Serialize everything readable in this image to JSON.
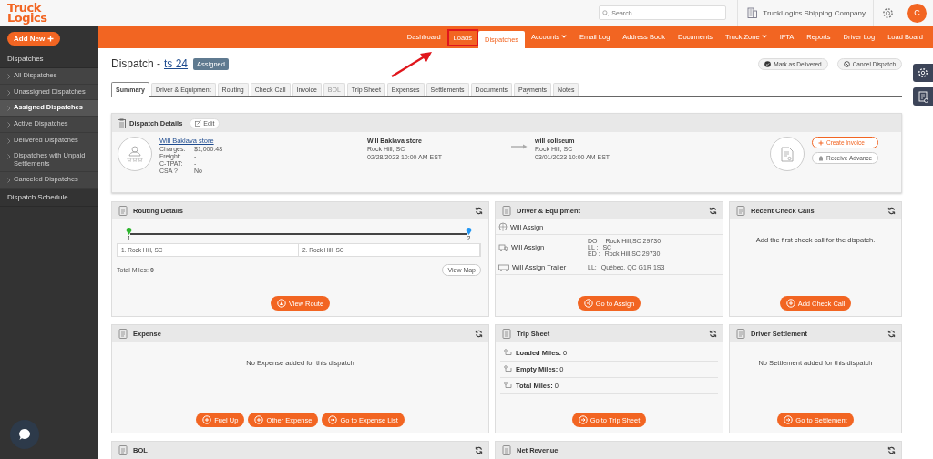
{
  "logo": {
    "line1": "Truck",
    "line2": "Logics"
  },
  "search": {
    "placeholder": "Search"
  },
  "company": "TruckLogics Shipping Company",
  "avatar": "C",
  "add_new": "Add New",
  "sidebar": [
    {
      "kind": "section",
      "label": "Dispatches"
    },
    {
      "kind": "item",
      "label": "All Dispatches",
      "selected": false
    },
    {
      "kind": "item",
      "label": "Unassigned Dispatches",
      "selected": false
    },
    {
      "kind": "item",
      "label": "Assigned Dispatches",
      "selected": true
    },
    {
      "kind": "item",
      "label": "Active Dispatches",
      "selected": false
    },
    {
      "kind": "item",
      "label": "Delivered Dispatches",
      "selected": false
    },
    {
      "kind": "item",
      "label": "Dispatches with Unpaid Settlements",
      "selected": false
    },
    {
      "kind": "item",
      "label": "Canceled Dispatches",
      "selected": false
    },
    {
      "kind": "section",
      "label": "Dispatch Schedule"
    }
  ],
  "nav": [
    {
      "label": "Dashboard",
      "selected": false,
      "dropdown": false,
      "highlighted": false
    },
    {
      "label": "Loads",
      "selected": false,
      "dropdown": false,
      "highlighted": true
    },
    {
      "label": "Dispatches",
      "selected": true,
      "dropdown": false,
      "highlighted": false
    },
    {
      "label": "Accounts",
      "selected": false,
      "dropdown": true,
      "highlighted": false
    },
    {
      "label": "Email Log",
      "selected": false,
      "dropdown": false,
      "highlighted": false
    },
    {
      "label": "Address Book",
      "selected": false,
      "dropdown": false,
      "highlighted": false
    },
    {
      "label": "Documents",
      "selected": false,
      "dropdown": false,
      "highlighted": false
    },
    {
      "label": "Truck Zone",
      "selected": false,
      "dropdown": true,
      "highlighted": false
    },
    {
      "label": "IFTA",
      "selected": false,
      "dropdown": false,
      "highlighted": false
    },
    {
      "label": "Reports",
      "selected": false,
      "dropdown": false,
      "highlighted": false
    },
    {
      "label": "Driver Log",
      "selected": false,
      "dropdown": false,
      "highlighted": false
    },
    {
      "label": "Load Board",
      "selected": false,
      "dropdown": false,
      "highlighted": false
    }
  ],
  "title": {
    "prefix": "Dispatch -",
    "link": "ts 24",
    "status": "Assigned"
  },
  "actions": [
    {
      "kind": "check",
      "label": "Mark as Delivered"
    },
    {
      "kind": "cancel",
      "label": "Cancel Dispatch"
    }
  ],
  "tabs": [
    {
      "label": "Summary",
      "selected": true,
      "disabled": false
    },
    {
      "label": "Driver & Equipment",
      "selected": false,
      "disabled": false
    },
    {
      "label": "Routing",
      "selected": false,
      "disabled": false
    },
    {
      "label": "Check Call",
      "selected": false,
      "disabled": false
    },
    {
      "label": "Invoice",
      "selected": false,
      "disabled": false
    },
    {
      "label": "BOL",
      "selected": false,
      "disabled": true
    },
    {
      "label": "Trip Sheet",
      "selected": false,
      "disabled": false
    },
    {
      "label": "Expenses",
      "selected": false,
      "disabled": false
    },
    {
      "label": "Settlements",
      "selected": false,
      "disabled": false
    },
    {
      "label": "Documents",
      "selected": false,
      "disabled": false
    },
    {
      "label": "Payments",
      "selected": false,
      "disabled": false
    },
    {
      "label": "Notes",
      "selected": false,
      "disabled": false
    }
  ],
  "details": {
    "title": "Dispatch Details",
    "edit": "Edit",
    "customer": "Will Baklava store",
    "fields": [
      {
        "label": "Charges:",
        "value": "$1,000.48"
      },
      {
        "label": "Freight:",
        "value": "-"
      },
      {
        "label": "C-TPAT:",
        "value": "-"
      },
      {
        "label": "CSA ?",
        "value": "No"
      }
    ],
    "pickup": {
      "name": "Will Baklava store",
      "city": "Rock Hill, SC",
      "time": "02/28/2023 10:00 AM EST"
    },
    "delivery": {
      "name": "will coliseum",
      "city": "Rock Hill, SC",
      "time": "03/01/2023 10:00 AM EST"
    },
    "buttons": [
      {
        "kind": "primary",
        "label": "Create Invoice"
      },
      {
        "kind": "plain",
        "label": "Receive Advance"
      }
    ]
  },
  "panels": [
    {
      "kind": "routing",
      "title": "Routing Details",
      "stops": [
        {
          "number": "1",
          "label": "1. Rock Hill, SC",
          "color": "#2db52d"
        },
        {
          "number": "2",
          "label": "2. Rock Hill, SC",
          "color": "#2196f3"
        }
      ],
      "total_label": "Total Miles:",
      "total_value": "0",
      "map": "View Map",
      "buttons": [
        {
          "kind": "route",
          "label": "View Route"
        }
      ]
    },
    {
      "kind": "equipment",
      "title": "Driver & Equipment",
      "rows": [
        {
          "kind": "driver",
          "name": "Will Assign",
          "details": []
        },
        {
          "kind": "truck",
          "name": "Will Assign",
          "details": [
            {
              "key": "DO :",
              "value": "Rock Hill,SC 29730"
            },
            {
              "key": "LL :",
              "value": "SC"
            },
            {
              "key": "ED :",
              "value": "Rock Hill,SC 29730"
            }
          ]
        },
        {
          "kind": "trailer",
          "name": "Will Assign Trailer",
          "details": [
            {
              "key": "LL:",
              "value": "Québec, QC G1R 1S3"
            }
          ]
        }
      ],
      "buttons": [
        {
          "kind": "arrow",
          "label": "Go to Assign"
        }
      ]
    },
    {
      "kind": "message",
      "title": "Recent Check Calls",
      "message": "Add the first check call for the dispatch.",
      "buttons": [
        {
          "kind": "plus",
          "label": "Add Check Call"
        }
      ]
    },
    {
      "kind": "message",
      "title": "Expense",
      "message": "No Expense added for this dispatch",
      "buttons": [
        {
          "kind": "plus",
          "label": "Fuel Up"
        },
        {
          "kind": "plus",
          "label": "Other Expense"
        },
        {
          "kind": "arrow",
          "label": "Go to Expense List"
        }
      ]
    },
    {
      "kind": "miles",
      "title": "Trip Sheet",
      "rows": [
        {
          "label": "Loaded Miles:",
          "value": "0"
        },
        {
          "label": "Empty Miles:",
          "value": "0"
        },
        {
          "label": "Total Miles:",
          "value": "0"
        }
      ],
      "buttons": [
        {
          "kind": "arrow",
          "label": "Go to Trip Sheet"
        }
      ]
    },
    {
      "kind": "message",
      "title": "Driver Settlement",
      "message": "No Settlement added for this dispatch",
      "buttons": [
        {
          "kind": "arrow",
          "label": "Go to Settlement"
        }
      ]
    },
    {
      "kind": "empty",
      "title": "BOL"
    },
    {
      "kind": "empty",
      "title": "Net Revenue"
    }
  ]
}
